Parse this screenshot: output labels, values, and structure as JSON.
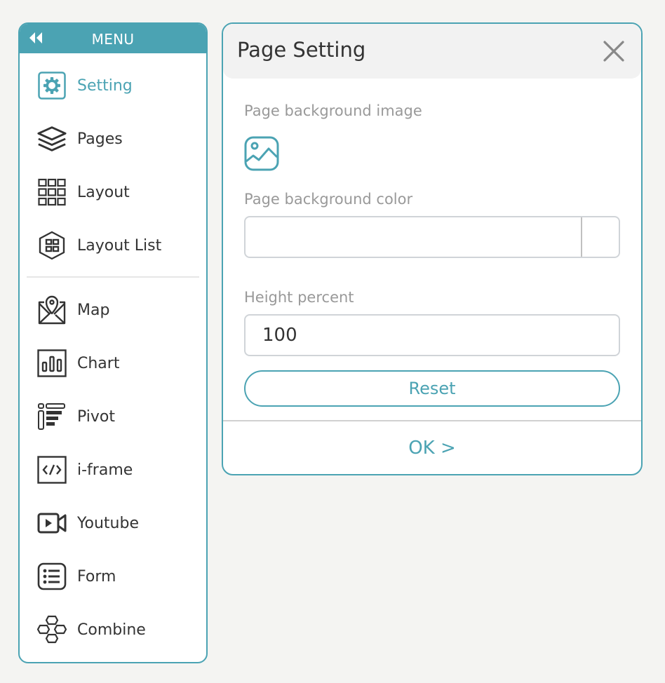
{
  "sidebar": {
    "title": "MENU",
    "collapse_icon": "double-chevron-left-icon",
    "items": [
      {
        "label": "Setting",
        "icon": "gear-icon",
        "active": true
      },
      {
        "label": "Pages",
        "icon": "layers-icon",
        "active": false
      },
      {
        "label": "Layout",
        "icon": "grid-icon",
        "active": false
      },
      {
        "label": "Layout List",
        "icon": "hexagon-grid-icon",
        "active": false
      },
      {
        "label": "Map",
        "icon": "map-pin-icon",
        "active": false
      },
      {
        "label": "Chart",
        "icon": "bar-chart-icon",
        "active": false
      },
      {
        "label": "Pivot",
        "icon": "pivot-icon",
        "active": false
      },
      {
        "label": "i-frame",
        "icon": "code-icon",
        "active": false
      },
      {
        "label": "Youtube",
        "icon": "video-icon",
        "active": false
      },
      {
        "label": "Form",
        "icon": "list-icon",
        "active": false
      },
      {
        "label": "Combine",
        "icon": "hexagons-icon",
        "active": false
      }
    ]
  },
  "dialog": {
    "title": "Page Setting",
    "close_icon": "close-icon",
    "background_image_label": "Page background image",
    "background_image_icon": "image-icon",
    "background_color_label": "Page background color",
    "background_color_value": "",
    "height_percent_label": "Height percent",
    "height_percent_value": "100",
    "reset_label": "Reset",
    "ok_label": "OK >"
  },
  "colors": {
    "accent": "#4ba3b3",
    "text": "#333333",
    "muted": "#999999",
    "background": "#f4f4f2"
  }
}
